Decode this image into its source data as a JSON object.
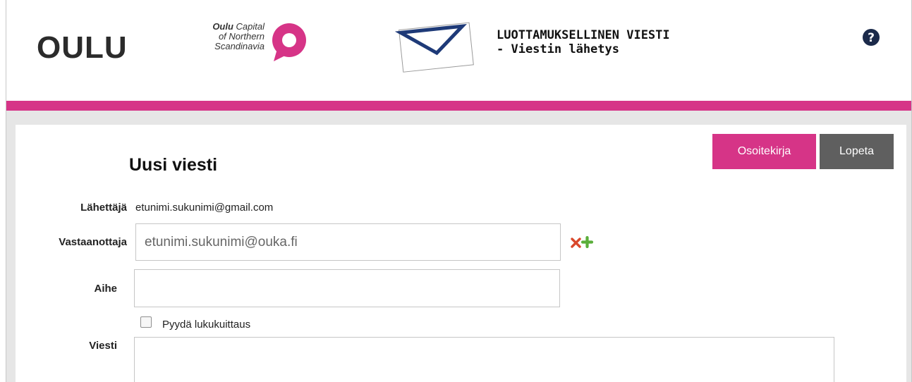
{
  "header": {
    "logo_text": "OULU",
    "tagline_bold": "Oulu",
    "tagline_line1_rest": " Capital",
    "tagline_line2": "of Northern",
    "tagline_line3": "Scandinavia",
    "title_line1": "LUOTTAMUKSELLINEN VIESTI",
    "title_line2": "- Viestin lähetys",
    "help_icon": "question-circle-icon"
  },
  "colors": {
    "accent_pink": "#d63487",
    "quit_button_gray": "#5f5f5f",
    "envelope_blue": "#1e3a78",
    "remove_red": "#d9482b",
    "add_green": "#5aae3a"
  },
  "toolbar": {
    "address_book_label": "Osoitekirja",
    "quit_label": "Lopeta"
  },
  "form": {
    "title": "Uusi viesti",
    "sender_label": "Lähettäjä",
    "sender_value": "etunimi.sukunimi@gmail.com",
    "recipient_label": "Vastaanottaja",
    "recipient_value": "etunimi.sukunimi@ouka.fi",
    "remove_icon": "remove-x-icon",
    "add_icon": "add-plus-icon",
    "subject_label": "Aihe",
    "subject_value": "",
    "read_receipt_label": "Pyydä lukukuittaus",
    "read_receipt_checked": false,
    "message_label": "Viesti",
    "message_value": ""
  }
}
